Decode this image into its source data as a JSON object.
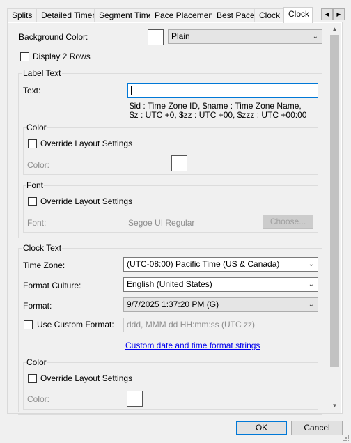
{
  "tabs": [
    {
      "label": "Splits"
    },
    {
      "label": "Detailed Timer"
    },
    {
      "label": "Segment Time"
    },
    {
      "label": "Pace Placement"
    },
    {
      "label": "Best Pace"
    },
    {
      "label": "Clock"
    },
    {
      "label": "Clock"
    }
  ],
  "tab_nav": {
    "left": "◀",
    "right": "▶"
  },
  "background": {
    "label": "Background Color:",
    "mode": "Plain"
  },
  "display_2_rows": {
    "label": "Display 2 Rows",
    "checked": false
  },
  "label_text": {
    "title": "Label Text",
    "text_label": "Text:",
    "text_value": "",
    "help_line1": "$id : Time Zone ID, $name : Time Zone Name,",
    "help_line2": "$z : UTC +0, $zz : UTC +00, $zzz : UTC +00:00",
    "color_group": {
      "title": "Color",
      "override_label": "Override Layout Settings",
      "color_label": "Color:"
    },
    "font_group": {
      "title": "Font",
      "override_label": "Override Layout Settings",
      "font_label": "Font:",
      "font_value": "Segoe UI Regular",
      "choose_label": "Choose..."
    }
  },
  "clock_text": {
    "title": "Clock Text",
    "timezone_label": "Time Zone:",
    "timezone_value": "(UTC-08:00) Pacific Time (US & Canada)",
    "culture_label": "Format Culture:",
    "culture_value": "English (United States)",
    "format_label": "Format:",
    "format_value": "9/7/2025 1:37:20 PM (G)",
    "custom_format_label": "Use Custom Format:",
    "custom_format_placeholder": "ddd, MMM dd HH:mm:ss (UTC zz)",
    "custom_link": "Custom date and time format strings",
    "color_group": {
      "title": "Color",
      "override_label": "Override Layout Settings",
      "color_label": "Color:"
    }
  },
  "buttons": {
    "ok": "OK",
    "cancel": "Cancel"
  },
  "icons": {
    "chevron": "chevron-down-icon",
    "resize": "resize-grip-icon"
  },
  "colors": {
    "focus": "#0078d7",
    "link": "#0000ee",
    "swatch": "#ffffff"
  }
}
